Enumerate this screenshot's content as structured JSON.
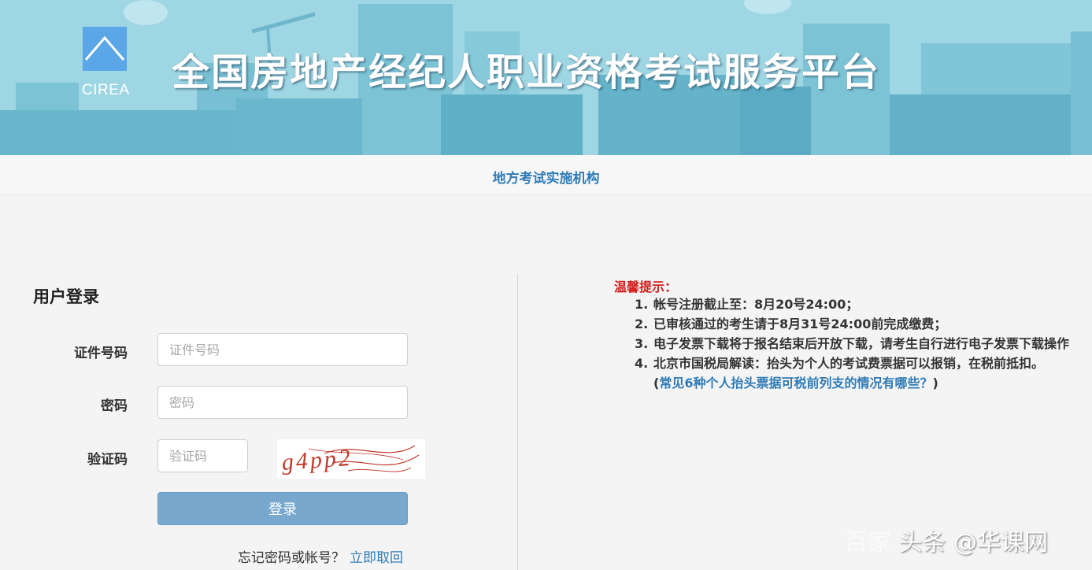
{
  "header": {
    "logo_text": "CIREA",
    "title": "全国房地产经纪人职业资格考试服务平台"
  },
  "nav": {
    "link": "地方考试实施机构"
  },
  "login": {
    "title": "用户登录",
    "id_label": "证件号码",
    "id_placeholder": "证件号码",
    "password_label": "密码",
    "password_placeholder": "密码",
    "captcha_label": "验证码",
    "captcha_placeholder": "验证码",
    "captcha_text": "g4pp2",
    "submit_label": "登录",
    "forgot_text": "忘记密码或帐号？",
    "retrieve_link": "立即取回"
  },
  "notice": {
    "title": "温馨提示：",
    "items": [
      {
        "num": "1.",
        "text": "帐号注册截止至：8月20号24:00；"
      },
      {
        "num": "2.",
        "text": "已审核通过的考生请于8月31号24:00前完成缴费；"
      },
      {
        "num": "3.",
        "text": "电子发票下载将于报名结束后开放下载，请考生自行进行电子发票下载操作"
      },
      {
        "num": "4.",
        "text": "北京市国税局解读：抬头为个人的考试费票据可以报销，在税前抵扣。",
        "open": "(",
        "link": "常见6种个人抬头票据可税前列支的情况有哪些？",
        "close": ")"
      }
    ]
  },
  "watermark": {
    "faint": "百家",
    "main": "头条 @华课网"
  },
  "colors": {
    "banner": "#8fd0e0",
    "accent": "#2f7bb6",
    "notice_title": "#d41d1d",
    "button": "#79a8cf"
  }
}
